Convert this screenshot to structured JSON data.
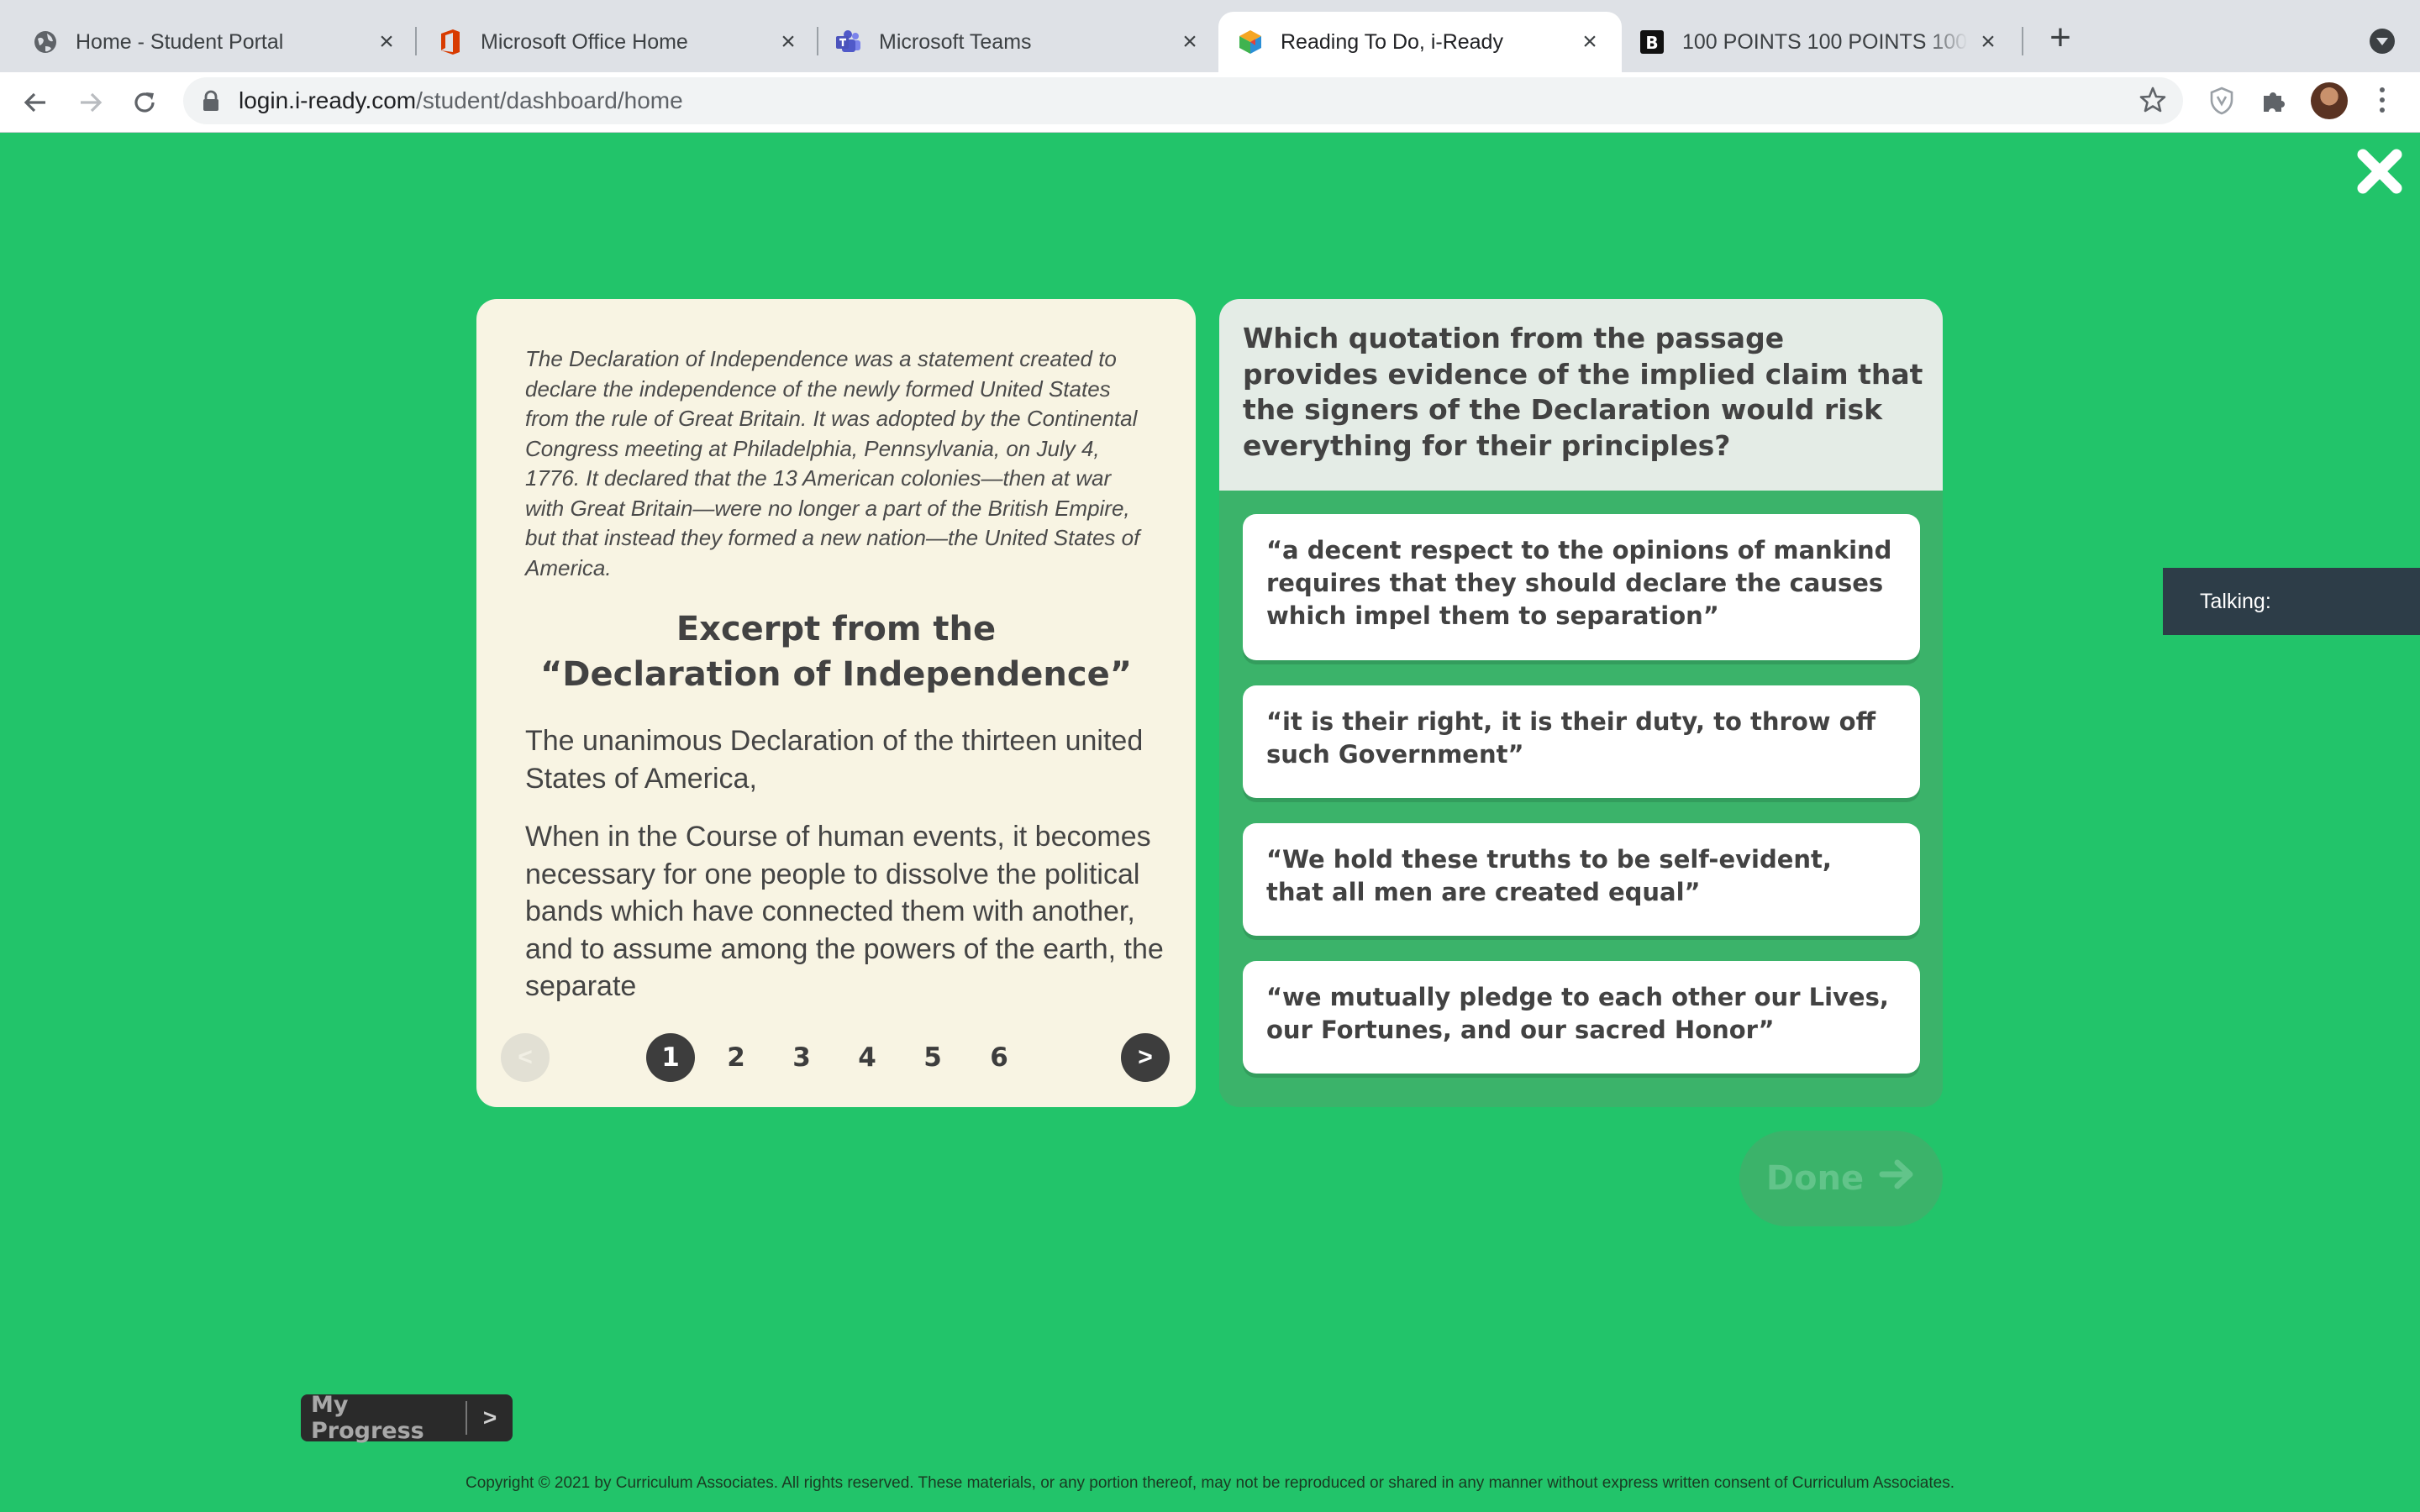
{
  "browser": {
    "tabs": [
      {
        "title": "Home - Student Portal",
        "icon": "globe-icon",
        "active": false
      },
      {
        "title": "Microsoft Office Home",
        "icon": "office-icon",
        "active": false
      },
      {
        "title": "Microsoft Teams",
        "icon": "teams-icon",
        "active": false
      },
      {
        "title": "Reading To Do, i-Ready",
        "icon": "iready-icon",
        "active": true
      },
      {
        "title": "100 POINTS 100 POINTS 100 P",
        "icon": "brainly-icon",
        "active": false
      }
    ],
    "url_domain": "login.i-ready.com",
    "url_path": "/student/dashboard/home"
  },
  "passage": {
    "intro": "The Declaration of Independence was a statement created to declare the independence of the newly formed United States from the rule of Great Britain. It was adopted by the Continental Congress meeting at Philadelphia, Pennsylvania, on July 4, 1776. It declared that the 13 American colonies—then at war with Great Britain—were no longer a part of the British Empire, but that instead they formed a new nation—the United States of America.",
    "title_line1": "Excerpt from the",
    "title_line2": "“Declaration of Independence”",
    "paragraph1": "The unanimous Declaration of the thirteen united States of America,",
    "paragraph2": "When in the Course of human events, it becomes necessary for one people to dissolve the political bands which have connected them with another, and to assume among the powers of the earth, the separate",
    "pager": {
      "prev": "<",
      "next": ">",
      "pages": [
        "1",
        "2",
        "3",
        "4",
        "5",
        "6"
      ],
      "current_page": "1"
    }
  },
  "question": {
    "text": "Which quotation from the passage provides evidence of the implied claim that the signers of the Declaration would risk everything for their principles?",
    "choices": [
      "“a decent respect to the opinions of mankind requires that they should declare the causes which impel them to separation”",
      "“it is their right, it is their duty, to throw off such Government”",
      "“We hold these truths to be self-evident, that all men are created equal”",
      "“we mutually pledge to each other our Lives, our Fortunes, and our sacred Honor”"
    ]
  },
  "done_label": "Done",
  "talking_label": "Talking:",
  "my_progress_label": "My Progress",
  "my_progress_arrow": ">",
  "copyright": "Copyright © 2021 by Curriculum Associates. All rights reserved. These materials, or any portion thereof, may not be reproduced or shared in any manner without express written consent of Curriculum Associates.",
  "colors": {
    "page_background": "#22c46a",
    "passage_background": "#f8f4e3",
    "question_panel": "#3bb36a",
    "question_header": "#e4ece6",
    "dark": "#3d3d3d"
  }
}
